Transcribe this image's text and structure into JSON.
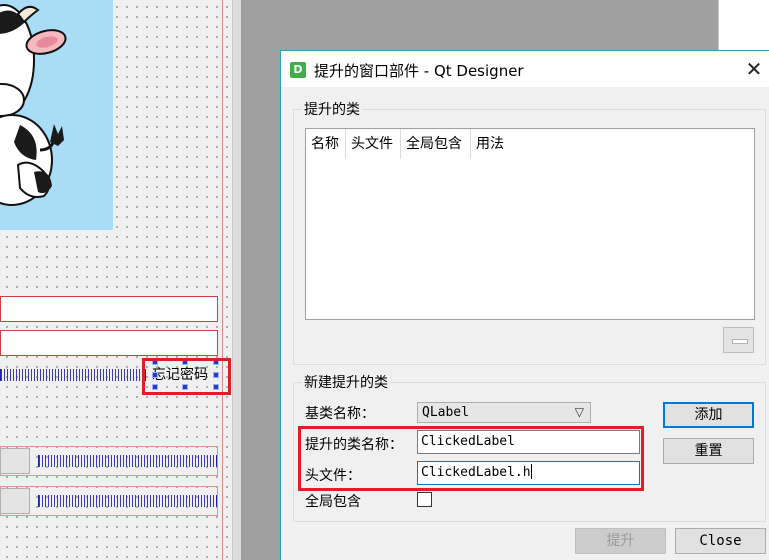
{
  "form": {
    "forget_password_label": "忘记密码"
  },
  "dialog": {
    "title": "提升的窗口部件 - Qt Designer",
    "app_icon_letter": "D",
    "close_glyph": "✕",
    "promoted_group": {
      "title": "提升的类",
      "columns": [
        "名称",
        "头文件",
        "全局包含",
        "用法"
      ]
    },
    "new_group": {
      "title": "新建提升的类",
      "base_class_label": "基类名称：",
      "base_class_value": "QLabel",
      "class_name_label": "提升的类名称：",
      "class_name_value": "ClickedLabel",
      "header_label": "头文件：",
      "header_value": "ClickedLabel.h",
      "global_include_label": "全局包含",
      "global_include_checked": false
    },
    "buttons": {
      "add": "添加",
      "reset": "重置",
      "promote": "提升",
      "close": "Close"
    }
  },
  "colors": {
    "highlight_box": "#e01e2a",
    "title_accent": "#2aa8b8",
    "focus_border": "#0078d7"
  }
}
